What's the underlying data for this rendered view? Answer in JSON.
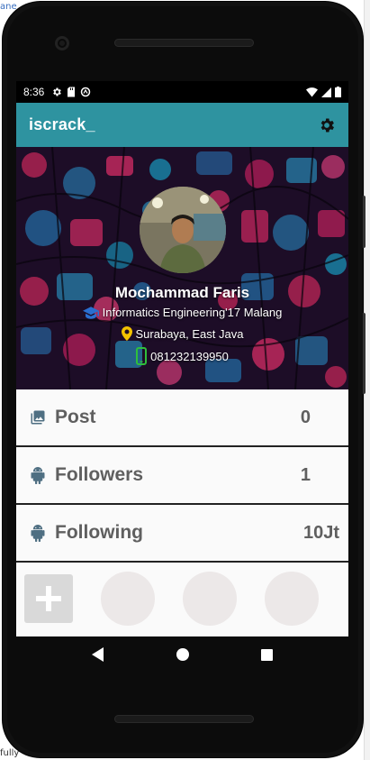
{
  "status_bar": {
    "time": "8:36"
  },
  "app_bar": {
    "title": "iscrack_",
    "settings_icon": "gear-icon"
  },
  "profile": {
    "name": "Mochammad Faris",
    "education": "Informatics Engineering'17 Malang",
    "location": "Surabaya, East Java",
    "phone": "081232139950"
  },
  "stats": [
    {
      "label": "Post",
      "value": "0",
      "icon": "image-icon"
    },
    {
      "label": "Followers",
      "value": "1",
      "icon": "android-icon"
    },
    {
      "label": "Following",
      "value": "10Jt",
      "icon": "android-icon"
    }
  ],
  "colors": {
    "app_bar": "#2e93a0",
    "stat_text": "#5f5f5f",
    "location_pin": "#f2c200",
    "phone_icon": "#2fbf3c",
    "education_icon": "#2a6fd1"
  }
}
